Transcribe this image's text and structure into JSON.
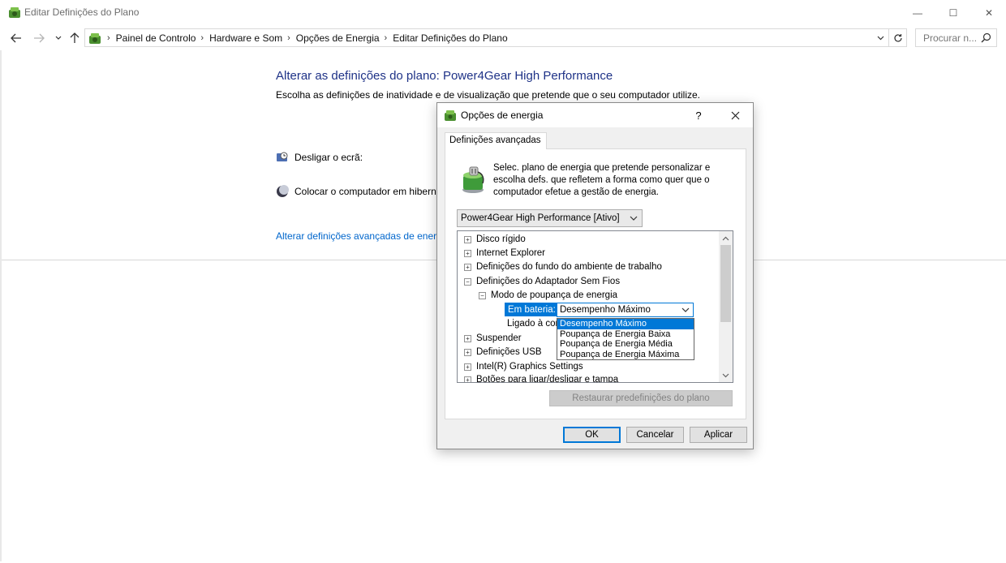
{
  "window": {
    "title": "Editar Definições do Plano",
    "minimize_glyph": "—",
    "maximize_glyph": "☐",
    "close_glyph": "✕"
  },
  "address": {
    "breadcrumbs": [
      {
        "label": "Painel de Controlo"
      },
      {
        "label": "Hardware e Som"
      },
      {
        "label": "Opções de Energia"
      },
      {
        "label": "Editar Definições do Plano"
      }
    ],
    "search_placeholder": "Procurar n..."
  },
  "content": {
    "heading": "Alterar as definições do plano: Power4Gear High Performance",
    "description": "Escolha as definições de inatividade e de visualização que pretende que o seu computador utilize.",
    "turn_off_display": "Desligar o ecrã:",
    "sleep": "Colocar o computador em hiberna",
    "advanced_link": "Alterar definições avançadas de energia"
  },
  "dialog": {
    "title": "Opções de energia",
    "help": "?",
    "tab": "Definições avançadas",
    "intro": "Selec. plano de energia que pretende personalizar e escolha defs. que refletem a forma como quer que o computador efetue a gestão de energia.",
    "plan_selected": "Power4Gear High Performance [Ativo]",
    "tree": [
      {
        "label": "Disco rígido",
        "expander": "+"
      },
      {
        "label": "Internet Explorer",
        "expander": "+"
      },
      {
        "label": "Definições do fundo do ambiente de trabalho",
        "expander": "+"
      },
      {
        "label": "Definições do Adaptador Sem Fios",
        "expander": "−"
      },
      {
        "label": "Modo de poupança de energia",
        "expander": "−"
      },
      {
        "label": "Em bateria:"
      },
      {
        "label": "Ligado à cor"
      },
      {
        "label": "Suspender",
        "expander": "+"
      },
      {
        "label": "Definições USB",
        "expander": "+"
      },
      {
        "label": "Intel(R) Graphics Settings",
        "expander": "+"
      },
      {
        "label": "Botões para ligar/desligar e tampa",
        "expander": "+"
      }
    ],
    "combo_value": "Desempenho Máximo",
    "dropdown_options": [
      "Desempenho Máximo",
      "Poupança de Energia Baixa",
      "Poupança de Energia Média",
      "Poupança de Energia Máxima"
    ],
    "restore_button": "Restaurar predefinições do plano",
    "ok": "OK",
    "cancel": "Cancelar",
    "apply": "Aplicar"
  }
}
